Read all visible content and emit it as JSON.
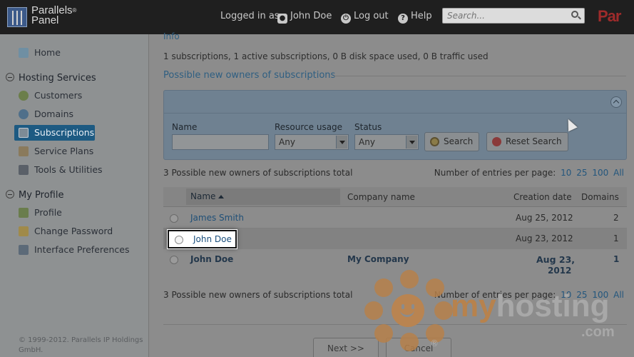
{
  "header": {
    "logo_line1": "Parallels",
    "logo_reg": "®",
    "logo_line2": "Panel",
    "logged_in_as": "Logged in as",
    "user_name": "John Doe",
    "logout": "Log out",
    "help": "Help",
    "search_placeholder": "Search...",
    "brand_right": "Par"
  },
  "sidebar": {
    "home": "Home",
    "hosting_services": "Hosting Services",
    "customers": "Customers",
    "domains": "Domains",
    "subscriptions": "Subscriptions",
    "service_plans": "Service Plans",
    "tools_utilities": "Tools & Utilities",
    "my_profile": "My Profile",
    "profile": "Profile",
    "change_password": "Change Password",
    "interface_preferences": "Interface Preferences",
    "copyright": "© 1999-2012. Parallels IP Holdings GmbH."
  },
  "main": {
    "info_heading": "Info",
    "summary": "1 subscriptions, 1 active subscriptions, 0 B disk space used, 0 B traffic used",
    "section_title": "Possible new owners of subscriptions",
    "filter": {
      "name_label": "Name",
      "resource_label": "Resource usage",
      "resource_value": "Any",
      "status_label": "Status",
      "status_value": "Any",
      "search_btn": "Search",
      "reset_btn": "Reset Search"
    },
    "total_text": "3 Possible new owners of subscriptions total",
    "per_page_label": "Number of entries per page:",
    "per_page_options": [
      "10",
      "25",
      "100",
      "All"
    ],
    "columns": {
      "name": "Name",
      "company": "Company name",
      "created": "Creation date",
      "domains": "Domains"
    },
    "rows": [
      {
        "name": "James Smith",
        "company": "",
        "created": "Aug 25, 2012",
        "domains": "2"
      },
      {
        "name": "John Doe",
        "company": "",
        "created": "Aug 23, 2012",
        "domains": "1"
      },
      {
        "name": "John Doe",
        "company": "My Company",
        "created_line1": "Aug 23,",
        "created_line2": "2012",
        "domains": "1"
      }
    ],
    "next_btn": "Next >>",
    "cancel_btn": "Cancel"
  },
  "watermark": {
    "text_my": "my",
    "text_hosting": "hosting",
    "text_com": ".com",
    "reg": "®"
  },
  "colors": {
    "header_bg": "#1f1f1f",
    "active_nav": "#1d5a82",
    "link": "#1f4f77",
    "watermark_orange": "#b7824d"
  }
}
